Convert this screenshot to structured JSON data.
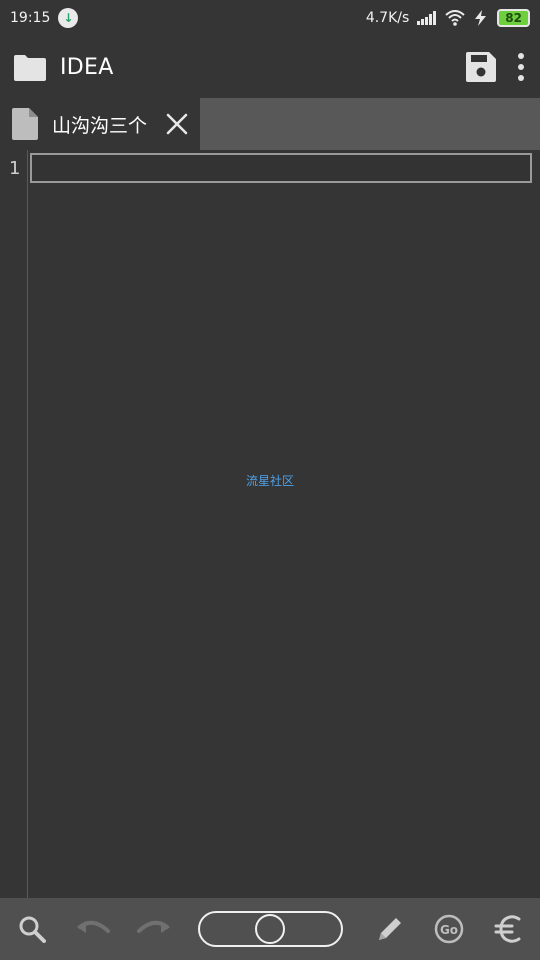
{
  "status_bar": {
    "time": "19:15",
    "network_speed": "4.7K/s",
    "battery": "82",
    "icons": [
      "download-icon",
      "signal-icon",
      "wifi-icon",
      "charging-icon"
    ]
  },
  "app_bar": {
    "title": "IDEA",
    "icons": [
      "folder-icon",
      "save-icon",
      "more-vert-icon"
    ]
  },
  "tabs": [
    {
      "label": "山沟沟三个",
      "active": true
    }
  ],
  "editor": {
    "line_numbers": [
      "1"
    ],
    "content": "",
    "watermark": "流星社区"
  },
  "toolbar": {
    "icons": [
      "search-icon",
      "undo-icon",
      "redo-icon",
      "nav-pill",
      "edit-icon",
      "go-icon",
      "euro-icon"
    ]
  },
  "colors": {
    "background": "#353535",
    "tab_strip": "#585858",
    "toolbar": "#505050",
    "battery": "#6ccf3b",
    "watermark": "#4ea1e8"
  }
}
